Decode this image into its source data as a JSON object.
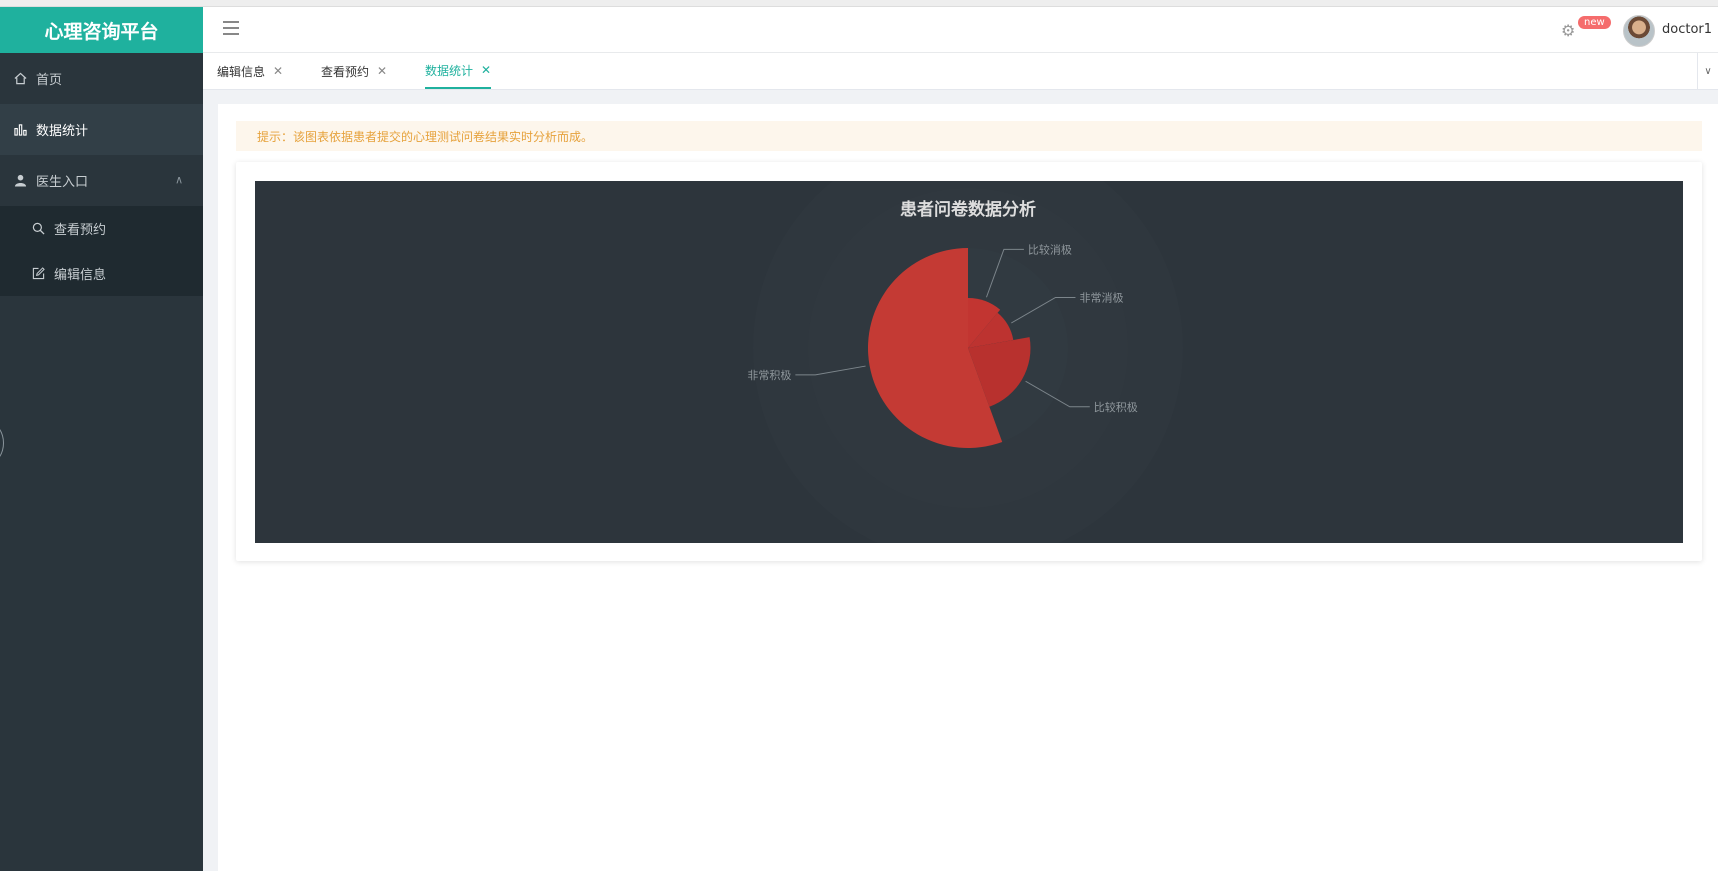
{
  "app": {
    "title": "心理咨询平台"
  },
  "sidebar": {
    "items": [
      {
        "label": "首页",
        "icon": "home-icon"
      },
      {
        "label": "数据统计",
        "icon": "bar-chart-icon"
      },
      {
        "label": "医生入口",
        "icon": "user-icon"
      }
    ],
    "submenu": [
      {
        "label": "查看预约",
        "icon": "search-icon"
      },
      {
        "label": "编辑信息",
        "icon": "edit-icon"
      }
    ]
  },
  "header": {
    "badge": "new",
    "username": "doctor1"
  },
  "tabs": [
    {
      "label": "编辑信息",
      "active": false
    },
    {
      "label": "查看预约",
      "active": false
    },
    {
      "label": "数据统计",
      "active": true
    }
  ],
  "alert": {
    "text": "提示：该图表依据患者提交的心理测试问卷结果实时分析而成。"
  },
  "colors": {
    "brand": "#1fb19e",
    "sidebar_bg": "#2a353c",
    "chart_bg": "#2d353c",
    "alert_text": "#e6a23c",
    "slice_fill": "#c23531"
  },
  "chart_data": {
    "type": "pie",
    "rose": true,
    "title": "患者问卷数据分析",
    "slices": [
      {
        "label": "比较消极",
        "value": 1
      },
      {
        "label": "非常消极",
        "value": 1
      },
      {
        "label": "比较积极",
        "value": 2
      },
      {
        "label": "非常积极",
        "value": 5
      }
    ]
  }
}
